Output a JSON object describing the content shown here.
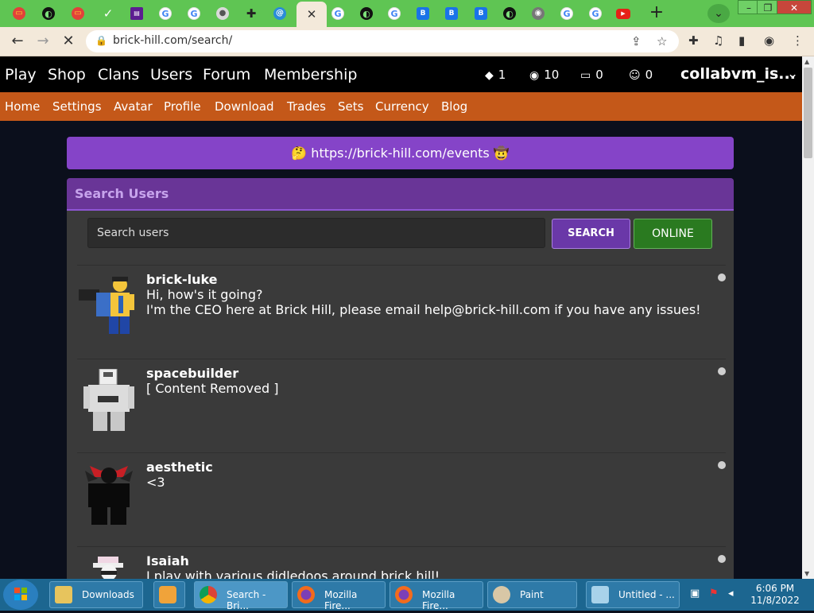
{
  "browser": {
    "tabs": [
      {
        "icon": "red-yellow-icon"
      },
      {
        "icon": "earth-icon"
      },
      {
        "icon": "red-yellow-icon"
      },
      {
        "icon": "checkmark-icon"
      },
      {
        "icon": "twitch-icon"
      },
      {
        "icon": "google-icon"
      },
      {
        "icon": "google-icon"
      },
      {
        "icon": "cookie-icon"
      },
      {
        "icon": "puzzle-icon"
      },
      {
        "icon": "message-icon"
      },
      {
        "icon": "close-icon",
        "active": true
      },
      {
        "icon": "google-icon"
      },
      {
        "icon": "earth-icon"
      },
      {
        "icon": "google-icon"
      },
      {
        "icon": "brick-hill-icon"
      },
      {
        "icon": "brick-hill-icon"
      },
      {
        "icon": "brick-hill-icon"
      },
      {
        "icon": "earth-icon"
      },
      {
        "icon": "chrome-icon"
      },
      {
        "icon": "google-icon"
      },
      {
        "icon": "google-icon"
      },
      {
        "icon": "youtube-icon"
      }
    ],
    "url": "brick-hill.com/search/"
  },
  "site": {
    "main_nav": [
      "Play",
      "Shop",
      "Clans",
      "Users",
      "Forum",
      "Membership"
    ],
    "stats": {
      "bricks": "1",
      "bucks": "10",
      "messages": "0",
      "friends": "0"
    },
    "username": "collabvm_is...",
    "sub_nav": [
      "Home",
      "Settings",
      "Avatar",
      "Profile",
      "Download",
      "Trades",
      "Sets",
      "Currency",
      "Blog"
    ],
    "banner": "https://brick-hill.com/events",
    "banner_emoji_left": "🤔",
    "banner_emoji_right": "🤠",
    "search_title": "Search Users",
    "search_placeholder": "Search users",
    "search_button": "SEARCH",
    "online_button": "ONLINE",
    "users": [
      {
        "name": "brick-luke",
        "blurb": "Hi, how's it going?\nI'm the CEO here at Brick Hill, please email help@brick-hill.com if you have any issues!"
      },
      {
        "name": "spacebuilder",
        "blurb": "[ Content Removed ]"
      },
      {
        "name": "aesthetic",
        "blurb": "<3"
      },
      {
        "name": "Isaiah",
        "blurb": "I play with various didledoos around brick hill!"
      }
    ]
  },
  "taskbar": {
    "items": [
      "Downloads",
      "Search - Bri...",
      "Mozilla Fire...",
      "Mozilla Fire...",
      "Paint",
      "Untitled - ..."
    ],
    "time": "6:06 PM",
    "date": "11/8/2022"
  }
}
